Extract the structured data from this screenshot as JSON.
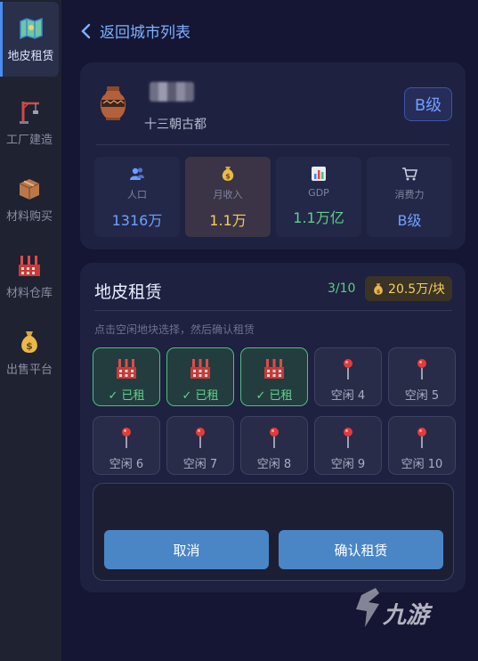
{
  "sidebar": {
    "items": [
      {
        "label": "地皮租赁",
        "icon": "map-icon",
        "active": true
      },
      {
        "label": "工厂建造",
        "icon": "crane-icon",
        "active": false
      },
      {
        "label": "材料购买",
        "icon": "box-icon",
        "active": false
      },
      {
        "label": "材料仓库",
        "icon": "factory-icon",
        "active": false
      },
      {
        "label": "出售平台",
        "icon": "money-bag-icon",
        "active": false
      }
    ]
  },
  "header": {
    "back_label": "返回城市列表"
  },
  "city": {
    "subtitle": "十三朝古都",
    "grade": "B级",
    "stats": [
      {
        "label": "人口",
        "value": "1316万",
        "icon": "people-icon",
        "color": "#6fa0ff"
      },
      {
        "label": "月收入",
        "value": "1.1万",
        "icon": "money-bag-icon",
        "color": "#f4cf52"
      },
      {
        "label": "GDP",
        "value": "1.1万亿",
        "icon": "bar-chart-icon",
        "color": "#5fd08a"
      },
      {
        "label": "消费力",
        "value": "B级",
        "icon": "cart-icon",
        "color": "#6fa0ff"
      }
    ]
  },
  "rent": {
    "title": "地皮租赁",
    "count": "3/10",
    "price": "20.5万/块",
    "hint": "点击空闲地块选择，然后确认租赁",
    "plots": [
      {
        "label": "✓ 已租",
        "status": "rented"
      },
      {
        "label": "✓ 已租",
        "status": "rented"
      },
      {
        "label": "✓ 已租",
        "status": "rented"
      },
      {
        "label": "空闲 4",
        "status": "free"
      },
      {
        "label": "空闲 5",
        "status": "free"
      },
      {
        "label": "空闲 6",
        "status": "free"
      },
      {
        "label": "空闲 7",
        "status": "free"
      },
      {
        "label": "空闲 8",
        "status": "free"
      },
      {
        "label": "空闲 9",
        "status": "free"
      },
      {
        "label": "空闲 10",
        "status": "free"
      }
    ],
    "cancel_label": "取消",
    "confirm_label": "确认租赁"
  },
  "watermark": {
    "text": "九游"
  },
  "colors": {
    "accent": "#4b8cf0",
    "rented": "#4cc07a",
    "button": "#4a86c5",
    "gold": "#f6cf5c"
  }
}
